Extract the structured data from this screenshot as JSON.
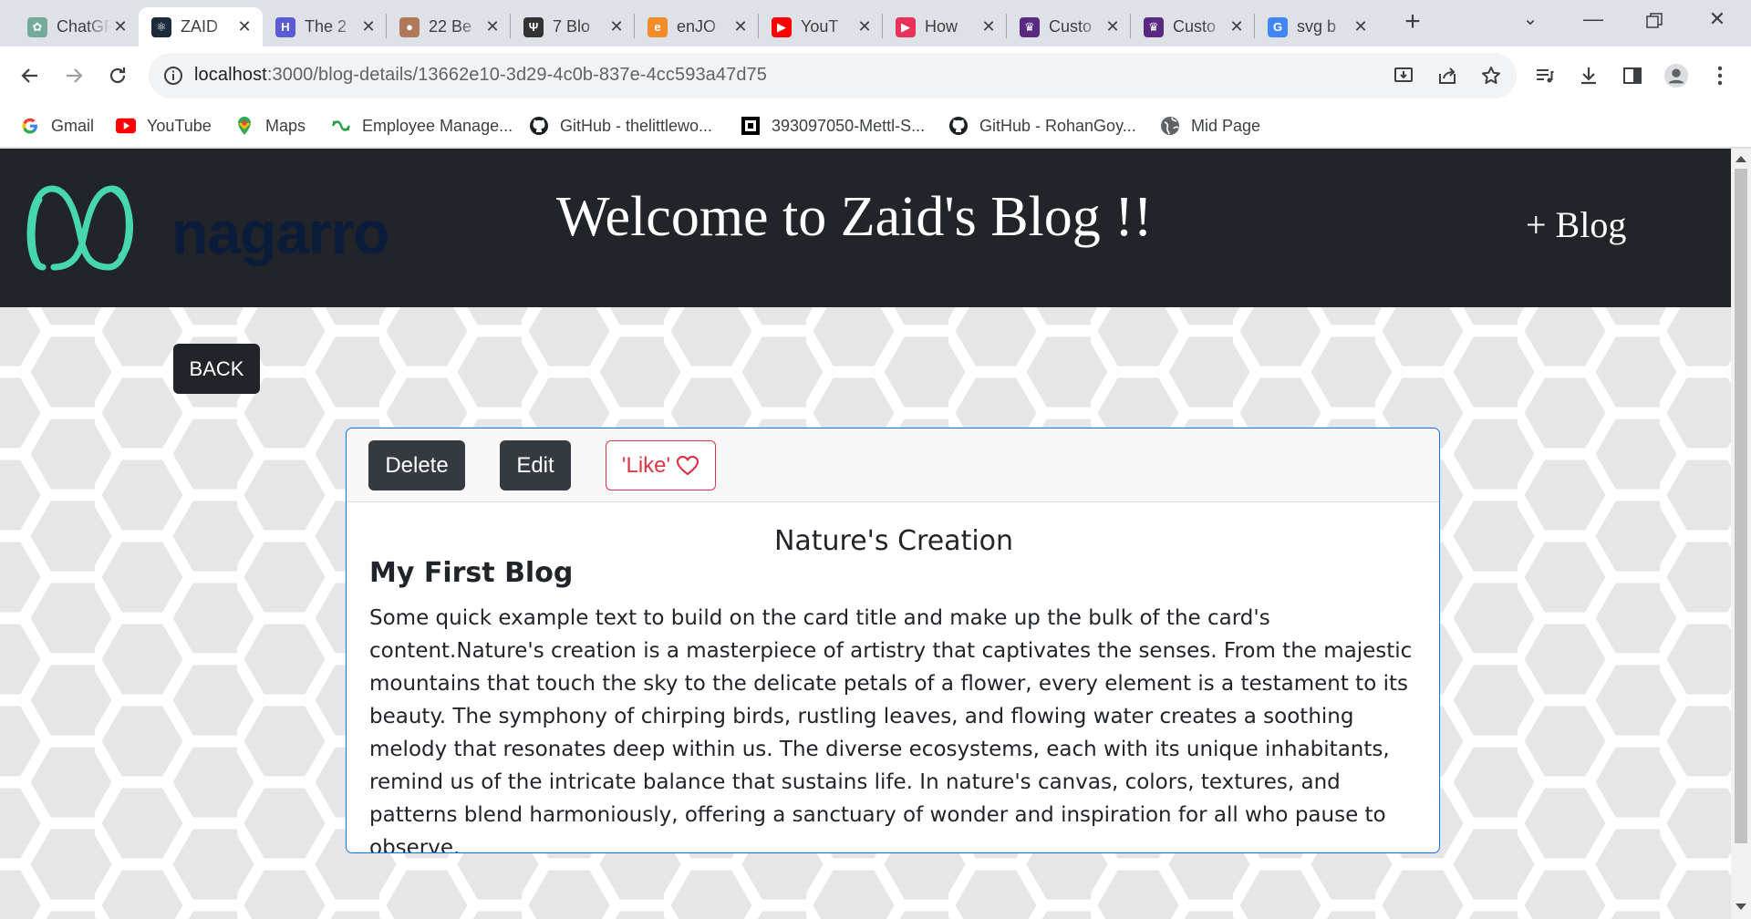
{
  "browser": {
    "tabs": [
      {
        "title": "ChatGPT",
        "icon": "chatgpt-icon",
        "color": "#74aa9c",
        "active": false
      },
      {
        "title": "ZAID",
        "icon": "react-icon",
        "color": "#1a2b3c",
        "active": true
      },
      {
        "title": "The 2",
        "icon": "hashnode-icon",
        "color": "#5b5bd6",
        "active": false
      },
      {
        "title": "22 Be",
        "icon": "profile-photo-icon",
        "color": "#b07a5a",
        "active": false
      },
      {
        "title": "7 Blo",
        "icon": "fork-knife-icon",
        "color": "#333333",
        "active": false
      },
      {
        "title": "enJO",
        "icon": "enjoy-icon",
        "color": "#f28c28",
        "active": false
      },
      {
        "title": "YouT",
        "icon": "youtube-icon",
        "color": "#ff0000",
        "active": false
      },
      {
        "title": "How",
        "icon": "play-circle-icon",
        "color": "#e8315b",
        "active": false
      },
      {
        "title": "Custo",
        "icon": "crown-icon",
        "color": "#5a2a82",
        "active": false
      },
      {
        "title": "Custo",
        "icon": "crown-icon",
        "color": "#5a2a82",
        "active": false
      },
      {
        "title": "svg b",
        "icon": "google-icon",
        "color": "#4285f4",
        "active": false
      }
    ],
    "url_host": "localhost",
    "url_path": ":3000/blog-details/13662e10-3d29-4c0b-837e-4cc593a47d75",
    "bookmarks": [
      {
        "label": "Gmail",
        "icon": "google-icon"
      },
      {
        "label": "YouTube",
        "icon": "youtube-icon"
      },
      {
        "label": "Maps",
        "icon": "maps-icon"
      },
      {
        "label": "Employee Manage...",
        "icon": "employee-icon"
      },
      {
        "label": "GitHub - thelittlewo...",
        "icon": "github-icon"
      },
      {
        "label": "393097050-Mettl-S...",
        "icon": "document-icon"
      },
      {
        "label": "GitHub - RohanGoy...",
        "icon": "github-icon"
      },
      {
        "label": "Mid Page",
        "icon": "globe-icon"
      }
    ]
  },
  "app": {
    "logo_text": "nagarro",
    "title": "Welcome to Zaid's Blog !!",
    "add_blog": "+ Blog",
    "back_label": "BACK",
    "colors": {
      "navbar": "#212529",
      "card_border": "#0d6efd",
      "like": "#dc3545",
      "logo_green": "#47d7ac",
      "logo_text": "#0b1b3a"
    }
  },
  "card": {
    "delete_label": "Delete",
    "edit_label": "Edit",
    "like_label": "'Like'",
    "subtitle": "Nature's Creation",
    "title": "My First Blog",
    "text": "Some quick example text to build on the card title and make up the bulk of the card's content.Nature's creation is a masterpiece of artistry that captivates the senses. From the majestic mountains that touch the sky to the delicate petals of a flower, every element is a testament to its beauty. The symphony of chirping birds, rustling leaves, and flowing water creates a soothing melody that resonates deep within us. The diverse ecosystems, each with its unique inhabitants, remind us of the intricate balance that sustains life. In nature's canvas, colors, textures, and patterns blend harmoniously, offering a sanctuary of wonder and inspiration for all who pause to observe."
  }
}
